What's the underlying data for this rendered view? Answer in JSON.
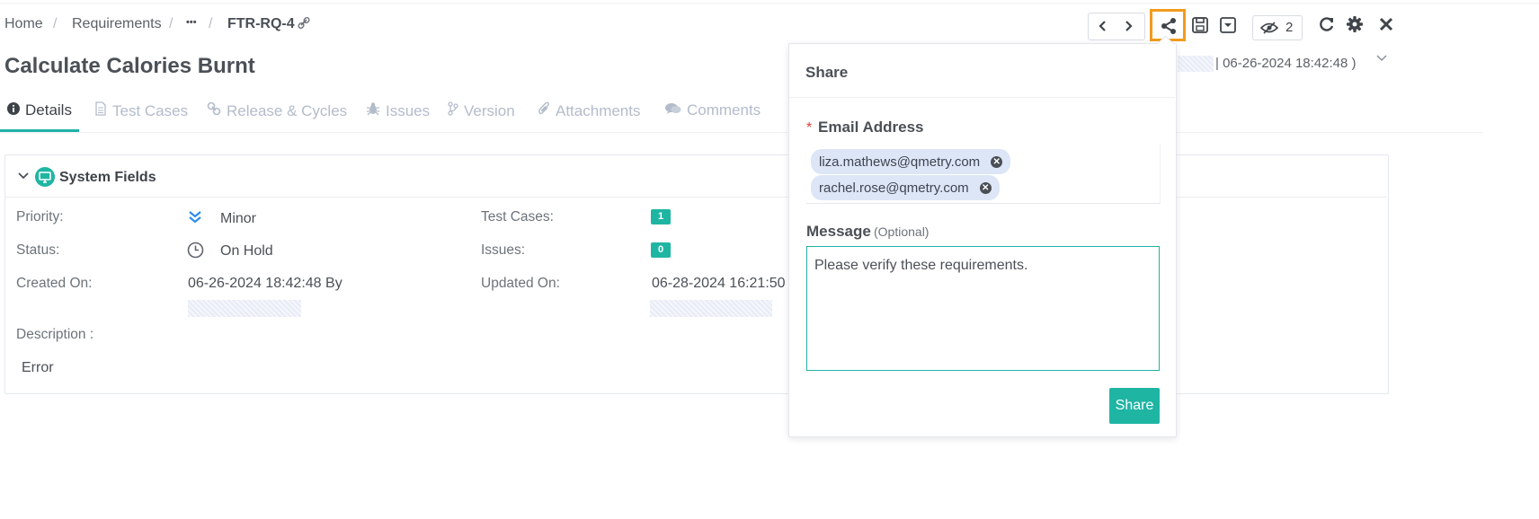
{
  "breadcrumb": {
    "home": "Home",
    "requirements": "Requirements",
    "ellipsis": "•••",
    "current": "FTR-RQ-4"
  },
  "title": "Calculate Calories Burnt",
  "header_meta": "| 06-26-2024 18:42:48 )",
  "toolbar": {
    "watch_count": "2"
  },
  "tabs": [
    {
      "label": "Details"
    },
    {
      "label": "Test Cases"
    },
    {
      "label": "Release & Cycles"
    },
    {
      "label": "Issues"
    },
    {
      "label": "Version"
    },
    {
      "label": "Attachments"
    },
    {
      "label": "Comments"
    }
  ],
  "system_fields": {
    "title": "System Fields",
    "priority_label": "Priority:",
    "priority_value": "Minor",
    "status_label": "Status:",
    "status_value": "On Hold",
    "created_label": "Created On:",
    "created_value": "06-26-2024 18:42:48 By",
    "test_cases_label": "Test Cases:",
    "test_cases_count": "1",
    "issues_label": "Issues:",
    "issues_count": "0",
    "updated_label": "Updated On:",
    "updated_value": "06-28-2024 16:21:50",
    "description_label": "Description :",
    "description_value": "Error"
  },
  "share_popup": {
    "title": "Share",
    "required_mark": "*",
    "email_label": "Email Address",
    "emails": [
      "liza.mathews@qmetry.com",
      "rachel.rose@qmetry.com"
    ],
    "message_label": "Message",
    "message_optional": "(Optional)",
    "message_value": "Please verify these requirements.",
    "share_button": "Share"
  },
  "colors": {
    "accent": "#1fb5a3",
    "highlight": "#f29b1d",
    "chip": "#dde6f7",
    "required": "#e0403a"
  }
}
